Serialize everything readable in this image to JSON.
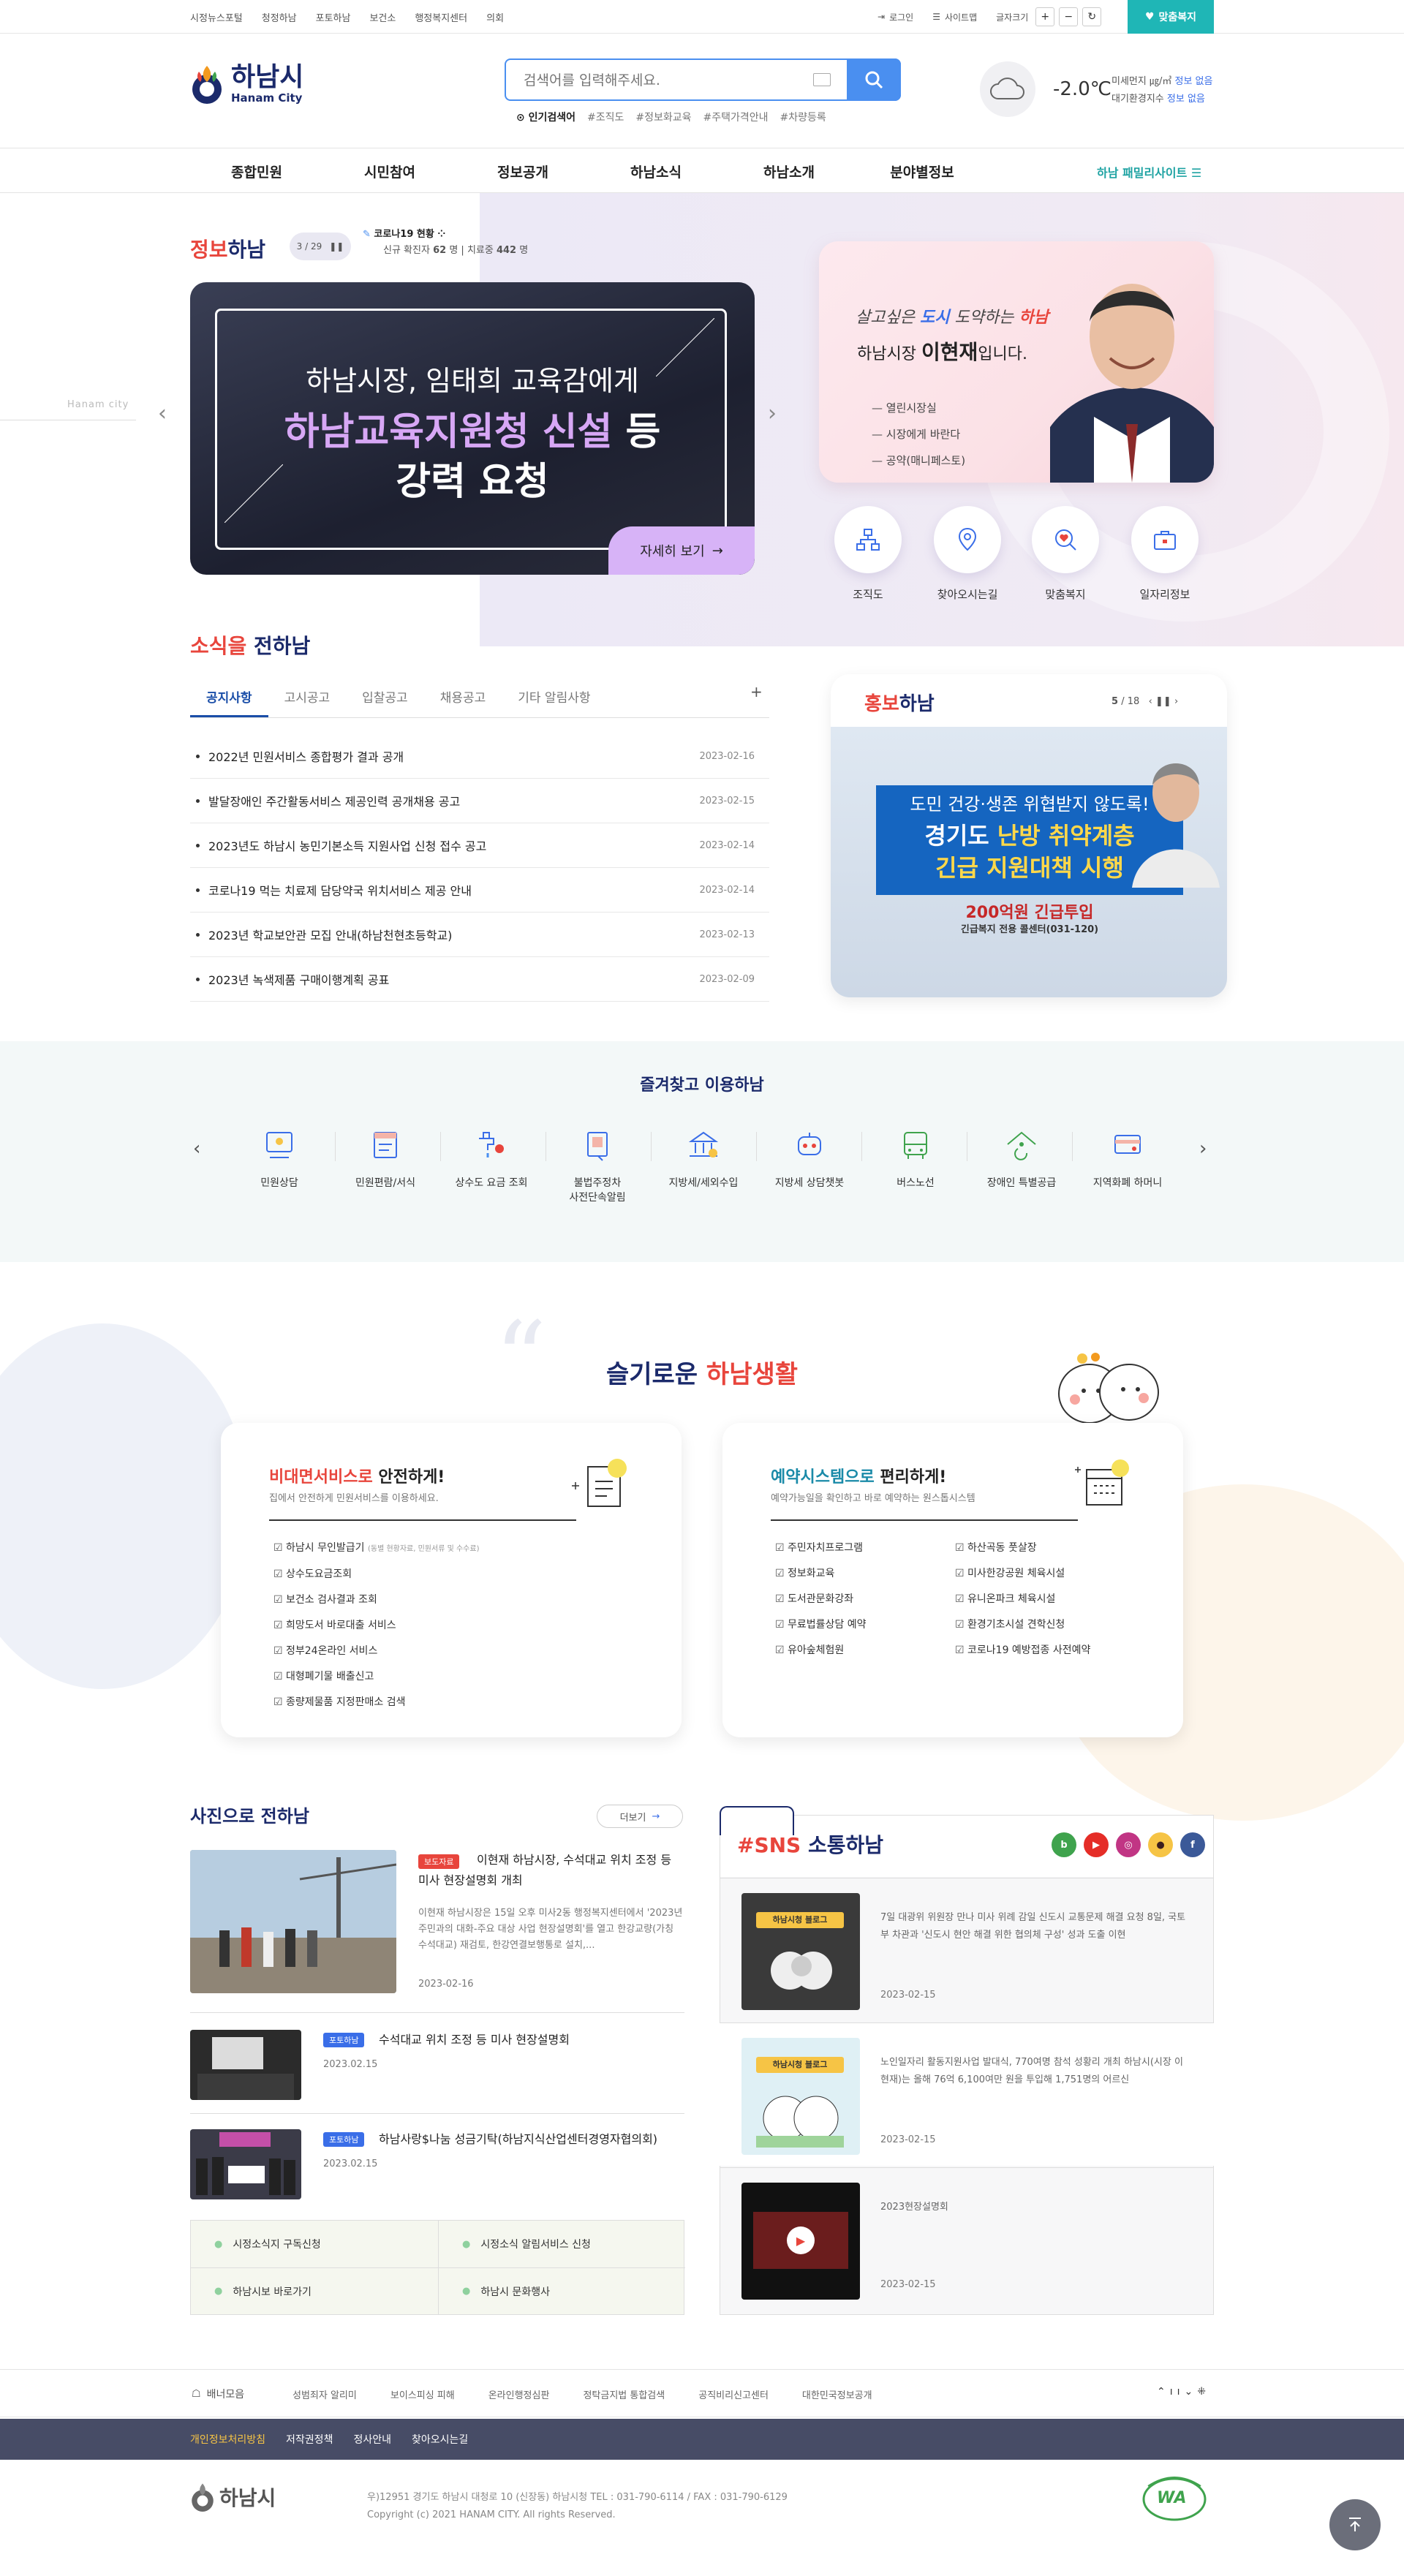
{
  "topbar": {
    "sites": [
      "시정뉴스포털",
      "청정하남",
      "포토하남",
      "보건소",
      "행정복지센터",
      "의회"
    ],
    "login": "로그인",
    "sitemap": "사이트맵",
    "font_size": "글자크기",
    "plus": "+",
    "minus": "−",
    "custom_welfare": "맞춤복지"
  },
  "header": {
    "logo_korean": "하남시",
    "logo_english": "Hanam City",
    "search_placeholder": "검색어를 입력해주세요.",
    "popular_label": "인기검색어",
    "popular": [
      "#조직도",
      "#정보화교육",
      "#주택가격안내",
      "#차량등록"
    ],
    "temperature": "-2.0℃",
    "fine_dust_label": "미세먼지 ㎍/㎥",
    "fine_dust_value": "정보 없음",
    "air_label": "대기환경지수",
    "air_value": "정보 없음"
  },
  "gnb": {
    "items": [
      "종합민원",
      "시민참여",
      "정보공개",
      "하남소식",
      "하남소개",
      "분야별정보"
    ],
    "family": "하남 패밀리사이트"
  },
  "info": {
    "title_red": "정보",
    "title_navy": "하남",
    "pager": "3 / 29",
    "covid_title": "코로나19 현황",
    "covid_new_label": "신규 확진자",
    "covid_new": "62",
    "covid_treat_label": "치료중",
    "covid_treat": "442",
    "covid_unit": "명",
    "side_text": "Hanam city"
  },
  "main_banner": {
    "line1": "하남시장, 임태희 교육감에게",
    "line2_highlight": "하남교육지원청 신설",
    "line2_rest": " 등",
    "line3": "강력 요청",
    "more": "자세히 보기"
  },
  "mayor": {
    "slogan_pre": "살고싶은 ",
    "slogan_mid": "도시",
    "slogan_post": " 도약하는 ",
    "slogan_end": "하남",
    "name_pre": "하남시장 ",
    "name": "이현재",
    "name_post": "입니다.",
    "links": [
      "열린시장실",
      "시장에게 바란다",
      "공약(매니페스토)"
    ]
  },
  "quick_menu": [
    "조직도",
    "찾아오시는길",
    "맞춤복지",
    "일자리정보"
  ],
  "news": {
    "title_red": "소식을",
    "title_navy": " 전하남",
    "tabs": [
      "공지사항",
      "고시공고",
      "입찰공고",
      "채용공고",
      "기타 알림사항"
    ],
    "plus": "+",
    "items": [
      {
        "title": "2022년 민원서비스 종합평가 결과 공개",
        "date": "2023-02-16"
      },
      {
        "title": "발달장애인 주간활동서비스 제공인력 공개채용 공고",
        "date": "2023-02-15"
      },
      {
        "title": "2023년도 하남시 농민기본소득 지원사업 신청 접수 공고",
        "date": "2023-02-14"
      },
      {
        "title": "코로나19 먹는 치료제 담당약국 위치서비스 제공 안내",
        "date": "2023-02-14"
      },
      {
        "title": "2023년 학교보안관 모집 안내(하남천현초등학교)",
        "date": "2023-02-13"
      },
      {
        "title": "2023년 녹색제품 구매이행계획 공표",
        "date": "2023-02-09"
      }
    ]
  },
  "promo": {
    "title_red": "홍보",
    "title_navy": "하남",
    "page_current": "5",
    "page_total": "/ 18",
    "line1": "도민 건강·생존 위협받지 않도록!",
    "line2_pre": "경기도 ",
    "line2_highlight": "난방 취약계층",
    "line3": "긴급 지원대책 시행",
    "line4": "200억원 긴급투입",
    "line5": "긴급복지 전용 콜센터(031-120)"
  },
  "favorites": {
    "title": "즐겨찾고 이용하남",
    "items": [
      "민원상담",
      "민원편람/서식",
      "상수도 요금 조회",
      "불법주정차\n사전단속알림",
      "지방세/세외수입",
      "지방세 상담챗봇",
      "버스노선",
      "장애인 특별공급",
      "지역화폐 하머니"
    ]
  },
  "smart": {
    "title_pre": "슬기로운 ",
    "title_red": "하남생활",
    "card1": {
      "heading_colored": "비대면서비스로",
      "heading_rest": " 안전하게!",
      "sub": "집에서 안전하게 민원서비스를 이용하세요.",
      "items": [
        "하남시 무인발급기",
        "상수도요금조회",
        "보건소 검사결과 조회",
        "희망도서 바로대출 서비스",
        "정부24온라인 서비스",
        "대형폐기물 배출신고",
        "종량제물품 지정판매소 검색"
      ],
      "first_note": "(동별 현황자료, 민원서류 및 수수료)"
    },
    "card2": {
      "heading_colored": "예약시스템으로",
      "heading_rest": " 편리하게!",
      "sub": "예약가능일을 확인하고 바로 예약하는 원스톱시스템",
      "col1": [
        "주민자치프로그램",
        "정보화교육",
        "도서관문화강좌",
        "무료법률상담 예약",
        "유아숲체험원"
      ],
      "col2": [
        "하산곡동 풋살장",
        "미사한강공원 체육시설",
        "유니온파크 체육시설",
        "환경기초시설 견학신청",
        "코로나19 예방접종 사전예약"
      ]
    }
  },
  "photo_news": {
    "title": "사진으로 전하남",
    "more": "더보기",
    "main": {
      "tag": "보도자료",
      "title": "이현재 하남시장, 수석대교 위치 조정 등 미사 현장설명회 개최",
      "desc": "이현재 하남시장은 15일 오후 미사2동 행정복지센터에서 '2023년 주민과의 대화-주요 대상 사업 현장설명회'를 열고 한강교량(가칭 수석대교) 재검토, 한강연결보행통로 설치,...",
      "date": "2023-02-16"
    },
    "items": [
      {
        "tag": "포토하남",
        "title": "수석대교 위치 조정 등 미사 현장설명회",
        "date": "2023.02.15"
      },
      {
        "tag": "포토하남",
        "title": "하남사랑$나눔 성금기탁(하남지식산업센터경영자협의회)",
        "date": "2023.02.15"
      }
    ],
    "links": [
      "시정소식지 구독신청",
      "시정소식 알림서비스 신청",
      "하남시보 바로가기",
      "하남시 문화행사"
    ]
  },
  "sns": {
    "title_red": "#SNS",
    "title_navy": " 소통하남",
    "icons": [
      "b",
      "▶",
      "◎",
      "●",
      "f"
    ],
    "blog_label": "하남시청 블로그",
    "items": [
      {
        "text": "7일 대광위 위원장 만나 미사 위례 감일 신도시 교통문제 해결 요청 8일, 국토부 차관과 '신도시 현안 해결 위한 협의체 구성' 성과 도출 이현",
        "date": "2023-02-15"
      },
      {
        "text": "노인일자리 활동지원사업 발대식, 770여명 참석 성황리 개최 하남시(시장 이현재)는 올해 76억 6,100여만 원을 투입해 1,751명의 어르신",
        "date": "2023-02-15"
      },
      {
        "text": "2023현장설명회",
        "date": "2023-02-15"
      }
    ]
  },
  "footer": {
    "banner_label": "배너모음",
    "banners": [
      "성범죄자 알리미",
      "보이스피싱 피해",
      "온라인행정심판",
      "정탁금지법 통합검색",
      "공직비리신고센터",
      "대한민국정보공개"
    ],
    "nav": [
      "개인정보처리방침",
      "저작권정책",
      "정사안내",
      "찾아오시는길"
    ],
    "logo": "하남시",
    "address": "우)12951 경기도 하남시 대청로 10 (신장동) 하남시청 TEL : 031-790-6114 / FAX : 031-790-6129",
    "copyright": "Copyright (c) 2021 HANAM CITY. All rights Reserved.",
    "badge_text": "WA"
  },
  "colors": {
    "navy": "#1b2a6b",
    "red": "#e8453c",
    "teal": "#1fb6b6",
    "blue": "#4a8ff0"
  }
}
